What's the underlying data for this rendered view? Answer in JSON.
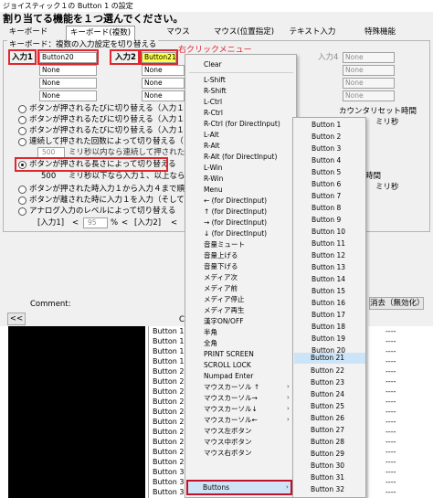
{
  "window": {
    "title": "ジョイスティック１の Button 1 の設定"
  },
  "heading": "割り当てる機能を１つ選んでください。",
  "tabs": [
    "キーボード",
    "キーボード(複数)",
    "マウス",
    "マウス(位置指定)",
    "テキスト入力",
    "特殊機能"
  ],
  "group_label": "キーボード：複数の入力設定を切り替える",
  "inputs": {
    "input1_label": "入力1",
    "input2_label": "入力2",
    "input4_label": "入力4",
    "col1": [
      "Button20",
      "None",
      "None",
      "None"
    ],
    "col2": [
      "Button21",
      "None",
      "None",
      "None"
    ],
    "col4": [
      "None",
      "None",
      "None",
      "None"
    ]
  },
  "annotation": "右クリックメニュー",
  "options": [
    "ボタンが押されるたびに切り替える（入力１→入力",
    "ボタンが押されるたびに切り替える（入力１→入力",
    "ボタンが押されるたびに切り替える（入力１→入力",
    "連続して押された回数によって切り替える（１回",
    "ボタンが押される長さによって切り替える",
    "ボタンが押された時入力１から入力４まで順番に",
    "ボタンが離された時に入力１を入力（そして押さ",
    "アナログ入力のレベルによって切り替える"
  ],
  "timing": {
    "value1": "500",
    "text1": "ミリ秒以内なら連続して押されたと",
    "value2": "500",
    "text2": "ミリ秒以下なら入力１、以上なら入"
  },
  "counter": {
    "title": "カウンタリセット時間",
    "unit": "ミリ秒",
    "time_label": "時間",
    "unit2": "ミリ秒"
  },
  "analog": {
    "label1": "[入力1]",
    "lt": "<",
    "value": "95",
    "pct": "%",
    "lt2": "<",
    "label2": "[入力2]",
    "lt3": "<"
  },
  "comment_label": "Comment:",
  "nav_prev": "<<",
  "nav_c": "C",
  "clear_button": "消去（無効化）",
  "list_rows": [
    "Button 16",
    "Button 17",
    "Button 18",
    "Button 19",
    "Button 20",
    "Button 21",
    "Button 22",
    "Button 23",
    "Button 24",
    "Button 25",
    "Button 26",
    "Button 27",
    "Button 28",
    "Button 29",
    "Button 30",
    "Button 31",
    "Button 32"
  ],
  "list_dashes": [
    "----",
    "----",
    "----",
    "----",
    "----",
    "----",
    "----",
    "----",
    "----",
    "----",
    "----",
    "----",
    "----",
    "----",
    "----",
    "----",
    "----"
  ],
  "context_menu": {
    "items": [
      "Clear",
      "L-Shift",
      "R-Shift",
      "L-Ctrl",
      "R-Ctrl",
      "R-Ctrl (for DirectInput)",
      "L-Alt",
      "R-Alt",
      "R-Alt (for DirectInput)",
      "L-Win",
      "R-Win",
      "Menu",
      "← (for DirectInput)",
      "↑ (for DirectInput)",
      "→ (for DirectInput)",
      "↓ (for DirectInput)",
      "音量ミュート",
      "音量上げる",
      "音量下げる",
      "メディア次",
      "メディア前",
      "メディア停止",
      "メディア再生",
      "漢字ON/OFF",
      "半角",
      "全角",
      "PRINT SCREEN",
      "SCROLL LOCK",
      "Numpad Enter",
      "マウスカーソル ↑",
      "マウスカーソル→",
      "マウスカーソル↓",
      "マウスカーソル←",
      "マウス左ボタン",
      "マウス中ボタン",
      "マウス右ボタン",
      "Buttons"
    ],
    "submenu_arrow": "›"
  },
  "submenu": {
    "items": [
      "Button 1",
      "Button 2",
      "Button 3",
      "Button 4",
      "Button 5",
      "Button 6",
      "Button 7",
      "Button 8",
      "Button 9",
      "Button 10",
      "Button 11",
      "Button 12",
      "Button 13",
      "Button 14",
      "Button 15",
      "Button 16",
      "Button 17",
      "Button 18",
      "Button 19",
      "Button 20",
      "Button 21",
      "Button 22",
      "Button 23",
      "Button 24",
      "Button 25",
      "Button 26",
      "Button 27",
      "Button 28",
      "Button 29",
      "Button 30",
      "Button 31",
      "Button 32"
    ],
    "highlighted": "Button 21"
  },
  "colors": {
    "annotation_red": "#e0262e",
    "highlight": "#cce4f7",
    "field_yellow": "#ffff4a"
  }
}
